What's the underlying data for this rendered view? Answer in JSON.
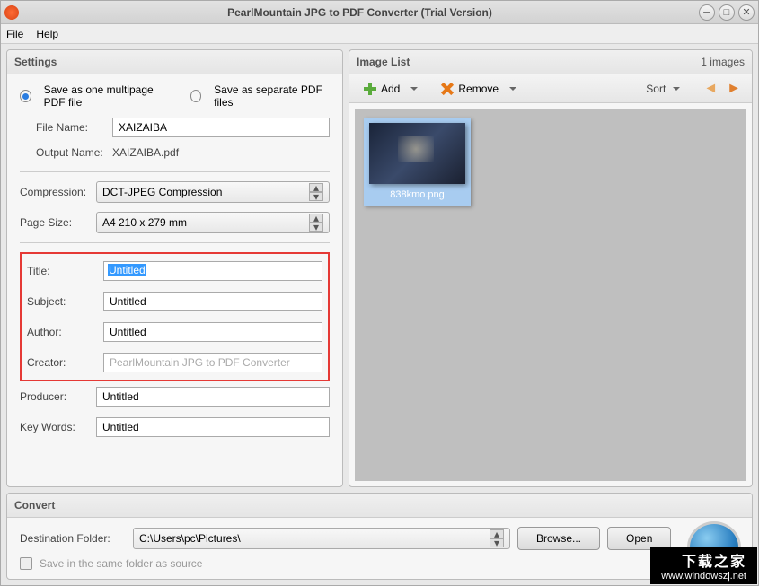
{
  "window": {
    "title": "PearlMountain JPG to PDF Converter (Trial Version)"
  },
  "menu": {
    "file": "File",
    "help": "Help"
  },
  "settings": {
    "header": "Settings",
    "saveModeOne": "Save as one multipage PDF file",
    "saveModeSeparate": "Save as separate PDF files",
    "fileNameLabel": "File Name:",
    "fileName": "XAIZAIBA",
    "outputNameLabel": "Output Name:",
    "outputName": "XAIZAIBA.pdf",
    "compressionLabel": "Compression:",
    "compression": "DCT-JPEG Compression",
    "pageSizeLabel": "Page Size:",
    "pageSize": "A4 210 x 279 mm",
    "titleLabel": "Title:",
    "title": "Untitled",
    "subjectLabel": "Subject:",
    "subject": "Untitled",
    "authorLabel": "Author:",
    "author": "Untitled",
    "creatorLabel": "Creator:",
    "creator": "PearlMountain JPG to PDF Converter",
    "producerLabel": "Producer:",
    "producer": "Untitled",
    "keywordsLabel": "Key Words:",
    "keywords": "Untitled"
  },
  "imagelist": {
    "header": "Image List",
    "count": "1 images",
    "add": "Add",
    "remove": "Remove",
    "sort": "Sort",
    "thumbName": "838kmo.png"
  },
  "convert": {
    "header": "Convert",
    "destLabel": "Destination Folder:",
    "destPath": "C:\\Users\\pc\\Pictures\\",
    "browse": "Browse...",
    "open": "Open",
    "sameFolder": "Save in the same folder as source"
  },
  "watermark": {
    "cn": "下载之家",
    "url": "www.windowszj.net"
  }
}
